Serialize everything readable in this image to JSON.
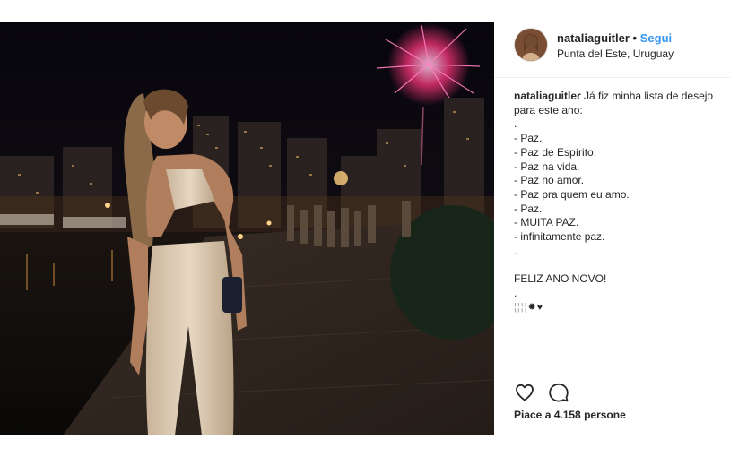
{
  "post": {
    "username": "nataliaguitler",
    "separator": "•",
    "follow_label": "Segui",
    "location": "Punta del Este, Uruguay",
    "caption": {
      "username": "nataliaguitler",
      "first_line": "Já fiz minha lista de desejo para este ano:",
      "lines": [
        ".",
        "- Paz.",
        "- Paz de Espírito.",
        "- Paz na vida.",
        "- Paz no amor.",
        "- Paz pra quem eu amo.",
        "- Paz.",
        "- MUITA PAZ.",
        "- infinitamente paz.",
        ".",
        "",
        "FELIZ ANO NOVO!",
        "."
      ]
    },
    "likes_text": "Piace a 4.158 persone",
    "icons": {
      "like": "heart-icon",
      "comment": "comment-icon",
      "emoji_sparkle": "sparkle-icon",
      "emoji_heart": "black-heart-icon"
    },
    "colors": {
      "follow": "#3897f0",
      "text": "#262626"
    }
  }
}
